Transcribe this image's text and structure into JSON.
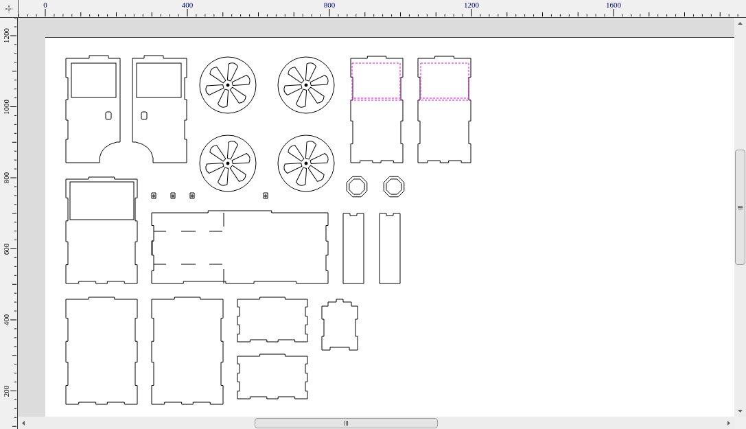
{
  "rulers": {
    "horizontal": {
      "labels": [
        "0",
        "400",
        "800",
        "1200",
        "1600"
      ]
    },
    "vertical": {
      "labels": [
        "1200",
        "1000",
        "800",
        "600",
        "400",
        "200"
      ]
    }
  }
}
